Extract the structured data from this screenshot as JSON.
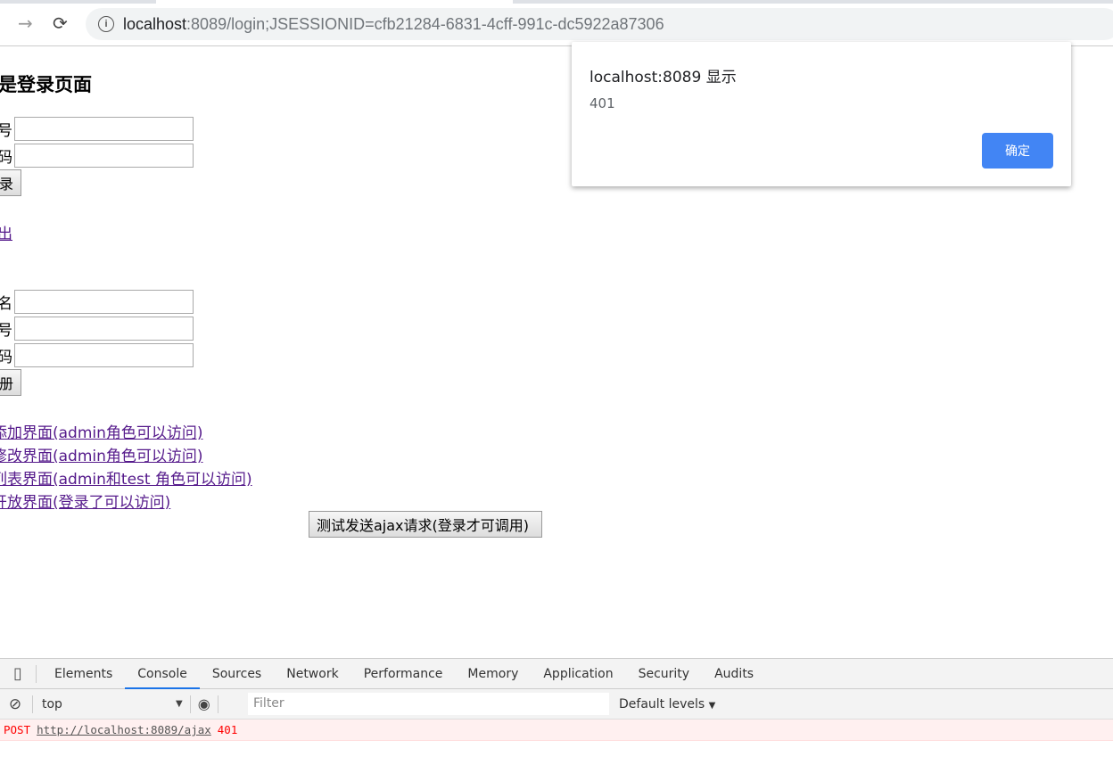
{
  "browser": {
    "url_host": "localhost",
    "url_rest": ":8089/login;JSESSIONID=cfb21284-6831-4cff-991c-dc5922a87306",
    "icons": [
      "forward-icon",
      "reload-icon",
      "info-icon"
    ]
  },
  "page": {
    "heading": "是登录页面",
    "login": {
      "account_label": "号:",
      "password_label": "码:",
      "submit_label": "录"
    },
    "logout_link": "出",
    "register": {
      "name_label": "名:",
      "account_label": "号:",
      "password_label": "码:",
      "submit_label": "册"
    },
    "links": [
      "添加界面(admin角色可以访问)",
      "修改界面(admin角色可以访问)",
      "列表界面(admin和test 角色可以访问)",
      "开放界面(登录了可以访问)"
    ],
    "ajax_button": "测试发送ajax请求(登录才可调用)"
  },
  "dialog": {
    "title": "localhost:8089 显示",
    "message": "401",
    "ok_label": "确定",
    "ok_color": "#4285f4"
  },
  "devtools": {
    "tabs": [
      "Elements",
      "Console",
      "Sources",
      "Network",
      "Performance",
      "Memory",
      "Application",
      "Security",
      "Audits"
    ],
    "active_tab": "Console",
    "context": "top",
    "filter_placeholder": "Filter",
    "levels": "Default levels",
    "log": {
      "method": "POST",
      "url": "http://localhost:8089/ajax",
      "status": "401"
    }
  }
}
